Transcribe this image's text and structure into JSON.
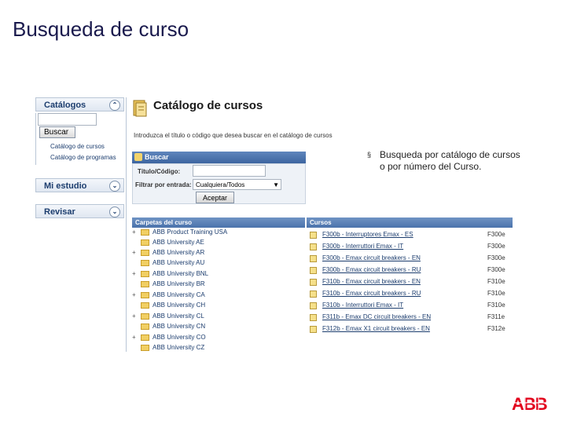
{
  "slide": {
    "title": "Busqueda de curso"
  },
  "sidebar": {
    "catalogs": "Catálogos",
    "search_button": "Buscar",
    "links": [
      "Catálogo de cursos",
      "Catálogo de programas"
    ],
    "my_studies": "Mi estudio",
    "review": "Revisar"
  },
  "catalog": {
    "title": "Catálogo de cursos",
    "instructions": "Introduzca el título o código que desea buscar en el catálogo de cursos"
  },
  "search": {
    "header": "Buscar",
    "title_code_label": "Título/Código:",
    "title_code_value": "",
    "filter_label": "Filtrar por entrada:",
    "filter_value": "Cualquiera/Todos",
    "accept": "Aceptar"
  },
  "folders": {
    "header": "Carpetas del curso",
    "items": [
      {
        "label": "ABB Product Training USA",
        "expand": "+"
      },
      {
        "label": "ABB University AE",
        "expand": ""
      },
      {
        "label": "ABB University AR",
        "expand": "+"
      },
      {
        "label": "ABB University AU",
        "expand": ""
      },
      {
        "label": "ABB University BNL",
        "expand": "+"
      },
      {
        "label": "ABB University BR",
        "expand": ""
      },
      {
        "label": "ABB University CA",
        "expand": "+"
      },
      {
        "label": "ABB University CH",
        "expand": ""
      },
      {
        "label": "ABB University CL",
        "expand": "+"
      },
      {
        "label": "ABB University CN",
        "expand": ""
      },
      {
        "label": "ABB University CO",
        "expand": "+"
      },
      {
        "label": "ABB University CZ",
        "expand": ""
      }
    ]
  },
  "courses": {
    "header": "Cursos",
    "items": [
      {
        "name": "F300b - Interruptores Emax - ES",
        "code": "F300e"
      },
      {
        "name": "F300b - Interruttori Emax - IT",
        "code": "F300e"
      },
      {
        "name": "F300b - Emax circuit breakers - EN",
        "code": "F300e"
      },
      {
        "name": "F300b - Emax circuit breakers - RU",
        "code": "F300e"
      },
      {
        "name": "F310b - Emax circuit breakers - EN",
        "code": "F310e"
      },
      {
        "name": "F310b - Emax circuit breakers - RU",
        "code": "F310e"
      },
      {
        "name": "F310b - Interruttori Emax - IT",
        "code": "F310e"
      },
      {
        "name": "F311b - Emax DC circuit breakers - EN",
        "code": "F311e"
      },
      {
        "name": "F312b - Emax X1 circuit breakers - EN",
        "code": "F312e"
      }
    ]
  },
  "note": {
    "bullet": "§",
    "text": "Busqueda por catálogo de cursos o por número del Curso."
  },
  "brand": {
    "logo": "ABB",
    "color": "#e2001a"
  }
}
